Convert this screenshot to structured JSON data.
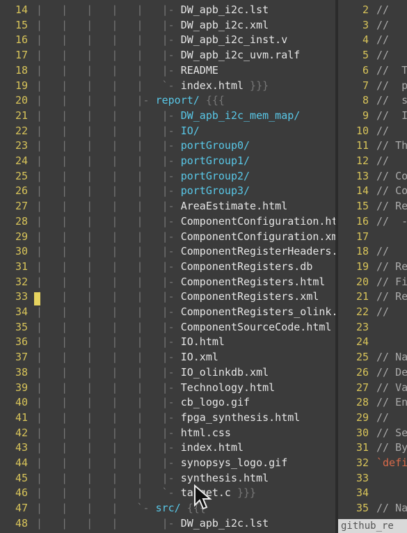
{
  "tree": {
    "lines": [
      {
        "num": "14",
        "prefix": "|   |   |   |   |   |- ",
        "name": "DW_apb_i2c.lst",
        "kind": "file",
        "suffix": ""
      },
      {
        "num": "15",
        "prefix": "|   |   |   |   |   |- ",
        "name": "DW_apb_i2c.xml",
        "kind": "file",
        "suffix": ""
      },
      {
        "num": "16",
        "prefix": "|   |   |   |   |   |- ",
        "name": "DW_apb_i2c_inst.v",
        "kind": "file",
        "suffix": ""
      },
      {
        "num": "17",
        "prefix": "|   |   |   |   |   |- ",
        "name": "DW_apb_i2c_uvm.ralf",
        "kind": "file",
        "suffix": ""
      },
      {
        "num": "18",
        "prefix": "|   |   |   |   |   |- ",
        "name": "README",
        "kind": "file",
        "suffix": ""
      },
      {
        "num": "19",
        "prefix": "|   |   |   |   |   `- ",
        "name": "index.html",
        "kind": "file",
        "suffix": " }}}"
      },
      {
        "num": "20",
        "prefix": "|   |   |   |   |- ",
        "name": "report/",
        "kind": "dir",
        "suffix": " {{{"
      },
      {
        "num": "21",
        "prefix": "|   |   |   |   |   |- ",
        "name": "DW_apb_i2c_mem_map/",
        "kind": "dir",
        "suffix": ""
      },
      {
        "num": "22",
        "prefix": "|   |   |   |   |   |- ",
        "name": "IO/",
        "kind": "dir",
        "suffix": ""
      },
      {
        "num": "23",
        "prefix": "|   |   |   |   |   |- ",
        "name": "portGroup0/",
        "kind": "dir",
        "suffix": ""
      },
      {
        "num": "24",
        "prefix": "|   |   |   |   |   |- ",
        "name": "portGroup1/",
        "kind": "dir",
        "suffix": ""
      },
      {
        "num": "25",
        "prefix": "|   |   |   |   |   |- ",
        "name": "portGroup2/",
        "kind": "dir",
        "suffix": ""
      },
      {
        "num": "26",
        "prefix": "|   |   |   |   |   |- ",
        "name": "portGroup3/",
        "kind": "dir",
        "suffix": ""
      },
      {
        "num": "27",
        "prefix": "|   |   |   |   |   |- ",
        "name": "AreaEstimate.html",
        "kind": "file",
        "suffix": ""
      },
      {
        "num": "28",
        "prefix": "|   |   |   |   |   |- ",
        "name": "ComponentConfiguration.html",
        "kind": "file",
        "suffix": ""
      },
      {
        "num": "29",
        "prefix": "|   |   |   |   |   |- ",
        "name": "ComponentConfiguration.xml",
        "kind": "file",
        "suffix": ""
      },
      {
        "num": "30",
        "prefix": "|   |   |   |   |   |- ",
        "name": "ComponentRegisterHeaders.htm",
        "kind": "file",
        "suffix": ""
      },
      {
        "num": "31",
        "prefix": "|   |   |   |   |   |- ",
        "name": "ComponentRegisters.db",
        "kind": "file",
        "suffix": ""
      },
      {
        "num": "32",
        "prefix": "|   |   |   |   |   |- ",
        "name": "ComponentRegisters.html",
        "kind": "file",
        "suffix": ""
      },
      {
        "num": "33",
        "prefix": "|   |   |   |   |   |- ",
        "name": "ComponentRegisters.xml",
        "kind": "file",
        "suffix": ""
      },
      {
        "num": "34",
        "prefix": "|   |   |   |   |   |- ",
        "name": "ComponentRegisters_olink.xml",
        "kind": "file",
        "suffix": ""
      },
      {
        "num": "35",
        "prefix": "|   |   |   |   |   |- ",
        "name": "ComponentSourceCode.html",
        "kind": "file",
        "suffix": ""
      },
      {
        "num": "36",
        "prefix": "|   |   |   |   |   |- ",
        "name": "IO.html",
        "kind": "file",
        "suffix": ""
      },
      {
        "num": "37",
        "prefix": "|   |   |   |   |   |- ",
        "name": "IO.xml",
        "kind": "file",
        "suffix": ""
      },
      {
        "num": "38",
        "prefix": "|   |   |   |   |   |- ",
        "name": "IO_olinkdb.xml",
        "kind": "file",
        "suffix": ""
      },
      {
        "num": "39",
        "prefix": "|   |   |   |   |   |- ",
        "name": "Technology.html",
        "kind": "file",
        "suffix": ""
      },
      {
        "num": "40",
        "prefix": "|   |   |   |   |   |- ",
        "name": "cb_logo.gif",
        "kind": "file",
        "suffix": ""
      },
      {
        "num": "41",
        "prefix": "|   |   |   |   |   |- ",
        "name": "fpga_synthesis.html",
        "kind": "file",
        "suffix": ""
      },
      {
        "num": "42",
        "prefix": "|   |   |   |   |   |- ",
        "name": "html.css",
        "kind": "file",
        "suffix": ""
      },
      {
        "num": "43",
        "prefix": "|   |   |   |   |   |- ",
        "name": "index.html",
        "kind": "file",
        "suffix": ""
      },
      {
        "num": "44",
        "prefix": "|   |   |   |   |   |- ",
        "name": "synopsys_logo.gif",
        "kind": "file",
        "suffix": ""
      },
      {
        "num": "45",
        "prefix": "|   |   |   |   |   |- ",
        "name": "synthesis.html",
        "kind": "file",
        "suffix": ""
      },
      {
        "num": "46",
        "prefix": "|   |   |   |   |   `- ",
        "name": "target.c",
        "kind": "file",
        "suffix": " }}}"
      },
      {
        "num": "47",
        "prefix": "|   |   |   |   `- ",
        "name": "src/",
        "kind": "dir",
        "suffix": " {{{"
      },
      {
        "num": "48",
        "prefix": "|   |   |   |       |- ",
        "name": "DW_apb_i2c.lst",
        "kind": "file",
        "suffix": ""
      }
    ]
  },
  "code": {
    "lines": [
      {
        "num": "2",
        "text": "//"
      },
      {
        "num": "3",
        "text": "//"
      },
      {
        "num": "4",
        "text": "//"
      },
      {
        "num": "5",
        "text": "//"
      },
      {
        "num": "6",
        "text": "//  T"
      },
      {
        "num": "7",
        "text": "//  p"
      },
      {
        "num": "8",
        "text": "//  s"
      },
      {
        "num": "9",
        "text": "//  I"
      },
      {
        "num": "10",
        "text": "//"
      },
      {
        "num": "11",
        "text": "// Th"
      },
      {
        "num": "12",
        "text": "//"
      },
      {
        "num": "13",
        "text": "// Co"
      },
      {
        "num": "14",
        "text": "// Co"
      },
      {
        "num": "15",
        "text": "// Re"
      },
      {
        "num": "16",
        "text": "//  -"
      },
      {
        "num": "17",
        "text": ""
      },
      {
        "num": "18",
        "text": "//"
      },
      {
        "num": "19",
        "text": "// Re"
      },
      {
        "num": "20",
        "text": "// Fi"
      },
      {
        "num": "21",
        "text": "// Re"
      },
      {
        "num": "22",
        "text": "//"
      },
      {
        "num": "23",
        "text": ""
      },
      {
        "num": "24",
        "text": ""
      },
      {
        "num": "25",
        "text": "// Na"
      },
      {
        "num": "26",
        "text": "// De"
      },
      {
        "num": "27",
        "text": "// Va"
      },
      {
        "num": "28",
        "text": "// En"
      },
      {
        "num": "29",
        "text": "//"
      },
      {
        "num": "30",
        "text": "// Se"
      },
      {
        "num": "31",
        "text": "// By"
      },
      {
        "num": "32",
        "text": "`defi"
      },
      {
        "num": "33",
        "text": ""
      },
      {
        "num": "34",
        "text": ""
      },
      {
        "num": "35",
        "text": "// Na"
      }
    ],
    "status_label": "github_re"
  },
  "colors": {
    "line_number": "#d8c45a",
    "directory": "#59c8e8",
    "file": "#e6e6e6",
    "background": "#3b3b3b"
  }
}
